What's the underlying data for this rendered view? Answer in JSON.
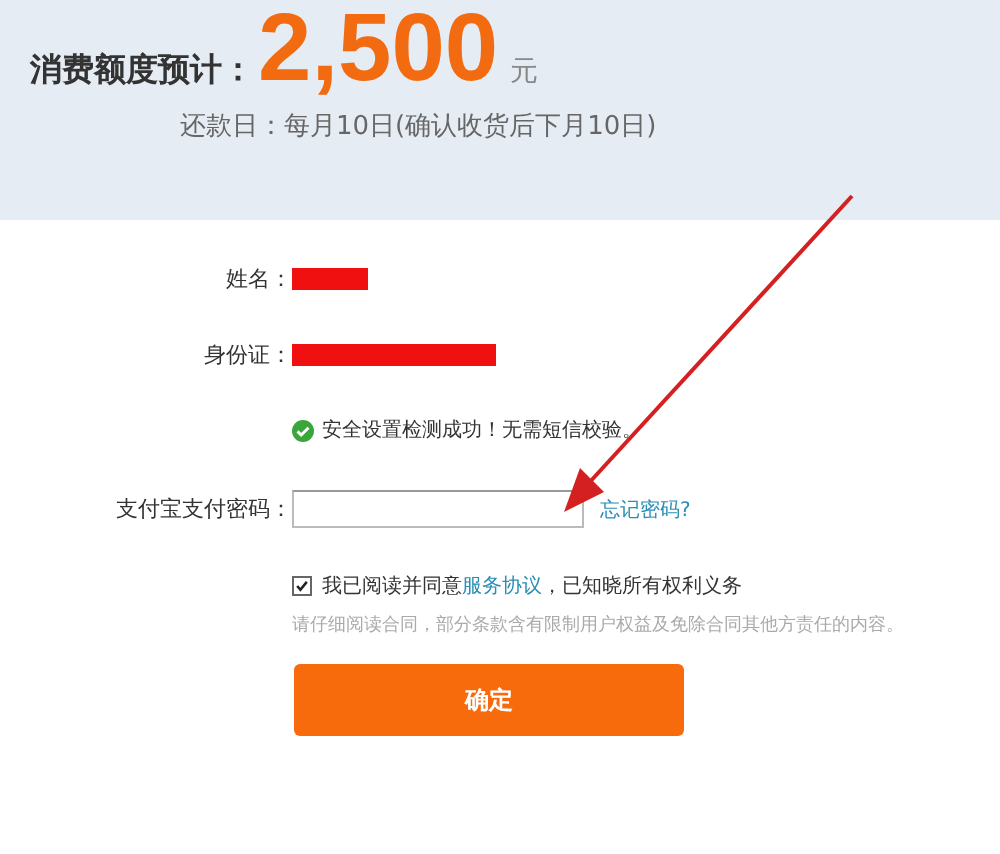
{
  "summary": {
    "label": "消费额度预计：",
    "amount": "2,500",
    "unit": "元",
    "repay_label": "还款日：",
    "repay_value": "每月10日(确认收货后下月10日)"
  },
  "fields": [
    {
      "label": "姓名：",
      "kind": "redacted"
    },
    {
      "label": "身份证：",
      "kind": "redacted"
    }
  ],
  "security_message": "安全设置检测成功！无需短信校验。",
  "password": {
    "label": "支付宝支付密码：",
    "link": "忘记密码?"
  },
  "agreement": {
    "checked": true,
    "text": "我已阅读并同意",
    "link": "服务协议",
    "suffix": "，已知晓所有权利义务",
    "note": "请仔细阅读合同，部分条款含有限制用户权益及免除合同其他方责任的内容。"
  },
  "submit": "确定"
}
